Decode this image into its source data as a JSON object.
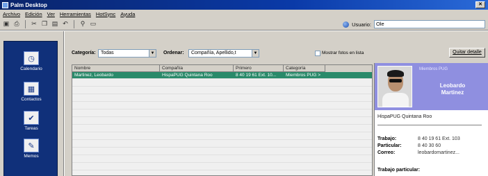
{
  "window": {
    "title": "Palm Desktop",
    "close_label": "✕"
  },
  "menu": [
    "Archivo",
    "Edición",
    "Ver",
    "Herramientas",
    "HotSync",
    "Ayuda"
  ],
  "toolbar": {
    "user_label": "Usuario:",
    "user_value": "Ole"
  },
  "nav": [
    {
      "label": "Calendario",
      "icon": "calendar-icon",
      "glyph": "◷"
    },
    {
      "label": "Contactos",
      "icon": "contacts-icon",
      "glyph": "▦"
    },
    {
      "label": "Tareas",
      "icon": "tasks-icon",
      "glyph": "✔"
    },
    {
      "label": "Memos",
      "icon": "memo-icon",
      "glyph": "✎"
    }
  ],
  "filters": {
    "category_label": "Categoría:",
    "category_value": "Todas",
    "sort_label": "Ordenar:",
    "sort_value": "Compañía, Apellido,t",
    "show_photos_label": "Mostrar fotos en lista",
    "edit_button": "Quitar detalle"
  },
  "grid": {
    "columns": [
      "Nombre",
      "Compañía",
      "Primero",
      "Categoría"
    ],
    "rows": [
      [
        "Martinez, Leobardo",
        "HispaPUG Quintana Roo",
        "8 40 19 61 Ext. 10...",
        "Miembros PUG >"
      ]
    ]
  },
  "detail": {
    "banner_label": "Miembros PUG",
    "first_name": "Leobardo",
    "last_name": "Martinez",
    "company": "HispaPUG Quintana Roo",
    "fields": [
      {
        "k": "Trabajo:",
        "v": "8 40 19 61 Ext. 103"
      },
      {
        "k": "Particular:",
        "v": "8 40 30 60"
      },
      {
        "k": "Correo:",
        "v": "leobardomartinez..."
      }
    ],
    "sub_heading": "Trabajo particular:"
  }
}
